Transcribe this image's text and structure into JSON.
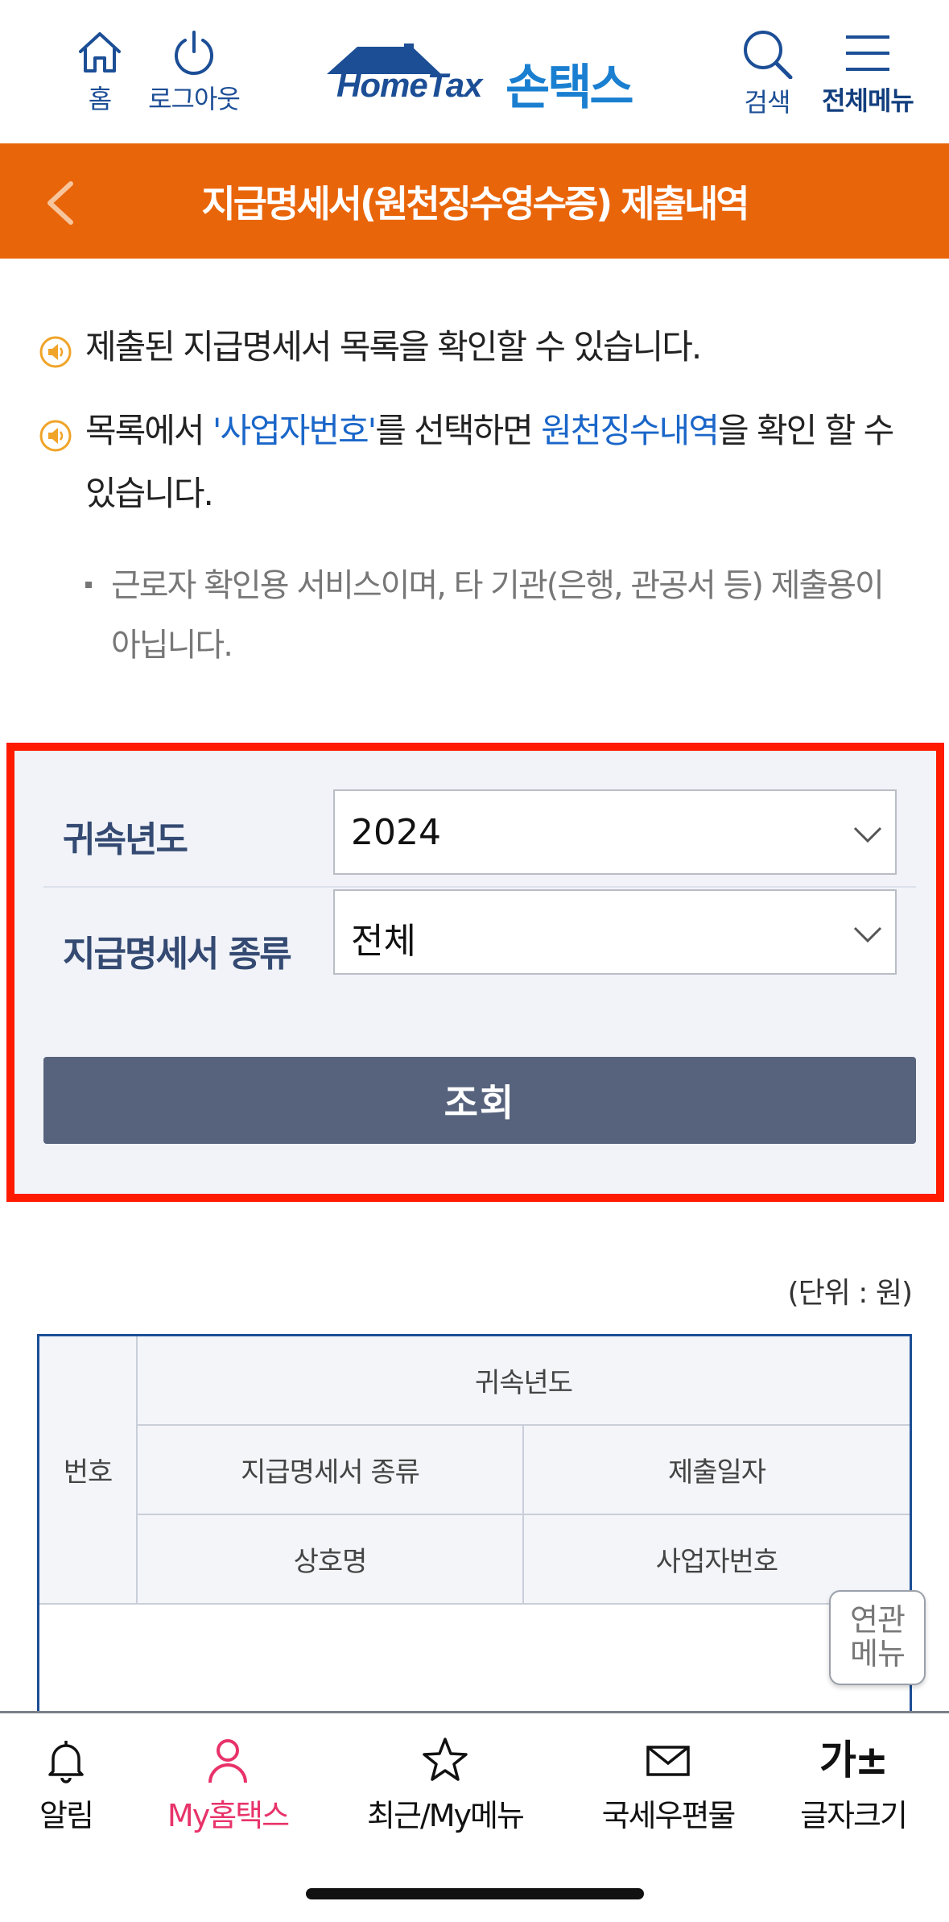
{
  "header": {
    "home_label": "홈",
    "logout_label": "로그아웃",
    "logo_en": "HomeTax",
    "logo_ko": "손택스",
    "search_label": "검색",
    "menu_label": "전체메뉴"
  },
  "title_bar": {
    "title": "지급명세서(원천징수영수증) 제출내역"
  },
  "notices": {
    "line1": "제출된 지급명세서 목록을 확인할 수 있습니다.",
    "line2_prefix": "목록에서 ",
    "line2_link1": "'사업자번호'",
    "line2_mid": "를 선택하면 ",
    "line2_link2": "원천징수내역",
    "line2_suffix": "을 확인 할 수 있습니다.",
    "subnote": "근로자 확인용 서비스이며, 타 기관(은행, 관공서 등) 제출용이 아닙니다."
  },
  "form": {
    "year_label": "귀속년도",
    "year_value": "2024",
    "kind_label": "지급명세서 종류",
    "kind_value": "전체",
    "submit_label": "조회"
  },
  "table": {
    "unit_note": "(단위 : 원)",
    "headers": {
      "number": "번호",
      "year": "귀속년도",
      "kind": "지급명세서 종류",
      "date": "제출일자",
      "company": "상호명",
      "biz_no": "사업자번호"
    }
  },
  "related_menu": {
    "line1": "연관",
    "line2": "메뉴"
  },
  "bottom_nav": {
    "alarm": "알림",
    "my_hometax": "My홈택스",
    "recent": "최근/My메뉴",
    "mail": "국세우편물",
    "font_glyph": "가±",
    "font_size": "글자크기"
  },
  "colors": {
    "accent_orange": "#e9650a",
    "brand_blue": "#1c4e96",
    "highlight_red": "#ff1a00",
    "button_slate": "#57637d",
    "active_pink": "#e8336a"
  }
}
